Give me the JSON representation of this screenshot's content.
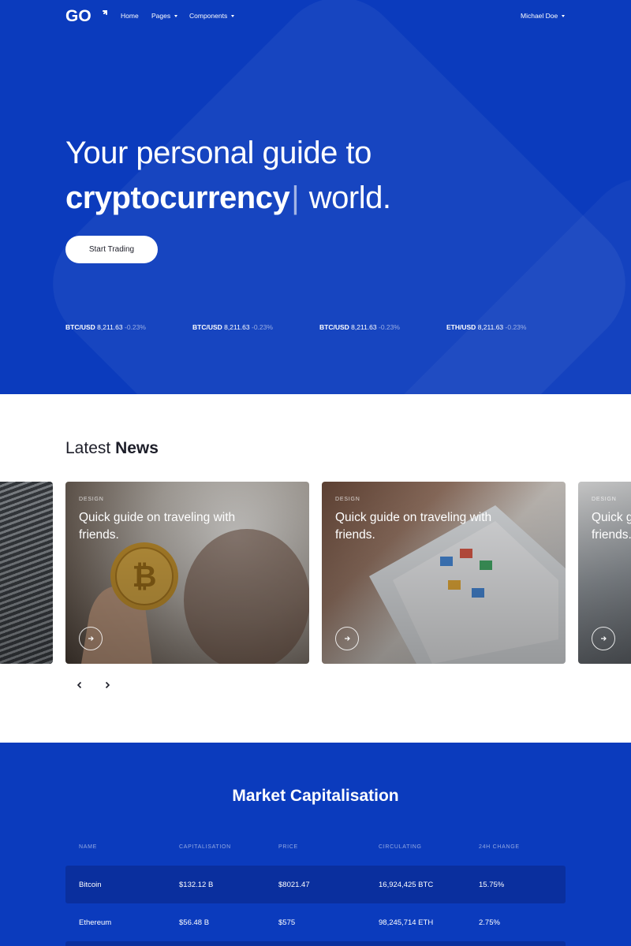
{
  "brand": {
    "logo_text": "GO"
  },
  "nav": {
    "home": "Home",
    "pages": "Pages",
    "components": "Components",
    "user": "Michael Doe"
  },
  "hero": {
    "line1": "Your personal guide to",
    "highlight": "cryptocurrency",
    "cursor": "|",
    "rest": "world.",
    "cta": "Start Trading"
  },
  "tickers": [
    {
      "pair": "BTC/USD",
      "price": "8,211.63",
      "change": "-0.23%"
    },
    {
      "pair": "BTC/USD",
      "price": "8,211.63",
      "change": "-0.23%"
    },
    {
      "pair": "BTC/USD",
      "price": "8,211.63",
      "change": "-0.23%"
    },
    {
      "pair": "ETH/USD",
      "price": "8,211.63",
      "change": "-0.23%"
    }
  ],
  "news": {
    "title_light": "Latest",
    "title_bold": "News",
    "cards": [
      {
        "category": "",
        "title": ""
      },
      {
        "category": "DESIGN",
        "title": "Quick guide on traveling with friends."
      },
      {
        "category": "DESIGN",
        "title": "Quick guide on traveling with friends."
      },
      {
        "category": "DESIGN",
        "title": "Quick guide on traveling with friends."
      }
    ]
  },
  "market": {
    "title_light": "Market",
    "title_bold": "Capitalisation",
    "columns": [
      "NAME",
      "CAPITALISATION",
      "PRICE",
      "CIRCULATING",
      "24H CHANGE"
    ],
    "rows": [
      [
        "Bitcoin",
        "$132.12 B",
        "$8021.47",
        "16,924,425 BTC",
        "15.75%"
      ],
      [
        "Ethereum",
        "$56.48 B",
        "$575",
        "98,245,714 ETH",
        "2.75%"
      ]
    ]
  },
  "colors": {
    "primary_blue": "#0b3bbd",
    "row_blue": "#0a2f9e",
    "text_dark": "#1d1e29"
  }
}
